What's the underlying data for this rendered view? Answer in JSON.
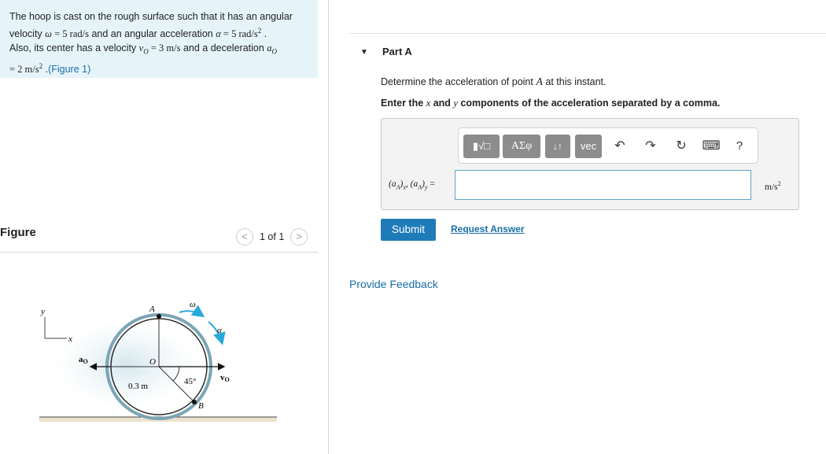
{
  "problem": {
    "line1": "The hoop is cast on the rough surface such that it has an angular",
    "line2_pre": "velocity ",
    "omega_sym": "ω",
    "line2_eq1": " = 5 rad/s",
    "line2_mid": " and an angular acceleration ",
    "alpha_sym": "α",
    "line2_eq2": " = 5 rad/s",
    "line2_exp": "2",
    "line2_end": " .",
    "line3_pre": "Also, its center has a velocity ",
    "vo_sym": "v",
    "vo_sub": "O",
    "line3_eq": " = 3 m/s",
    "line3_mid": " and a deceleration ",
    "ao_sym": "a",
    "ao_sub": "O",
    "line4_eq": "= 2 m/s",
    "line4_exp": "2",
    "line4_sep": " .",
    "figure_link": "(Figure 1)"
  },
  "figure_panel": {
    "title": "Figure",
    "prev": "<",
    "next": ">",
    "page_text": "1 of 1"
  },
  "figure": {
    "y_axis": "y",
    "x_axis": "x",
    "label_A": "A",
    "label_O": "O",
    "label_B": "B",
    "label_omega": "ω",
    "label_alpha": "α",
    "label_ao": "a",
    "label_ao_sub": "O",
    "label_vo": "v",
    "label_vo_sub": "O",
    "label_radius": "0.3 m",
    "label_angle": "45°"
  },
  "partA": {
    "title": "Part A",
    "prompt1_pre": "Determine the acceleration of point ",
    "prompt1_sym": "A",
    "prompt1_post": " at this instant.",
    "prompt2_a": "Enter the ",
    "prompt2_x": "x",
    "prompt2_b": " and ",
    "prompt2_y": "y",
    "prompt2_c": " components of the acceleration separated by a comma."
  },
  "toolbar": {
    "templates": "▮√□",
    "greek": "ΑΣφ",
    "arrows": "↓↑",
    "vec": "vec",
    "undo": "↶",
    "redo": "↷",
    "reset": "↻",
    "keyboard": "⌨",
    "help": "?"
  },
  "answer": {
    "label_a": "(a",
    "label_sub1": "A",
    "label_b": ")",
    "label_x": "x",
    "label_comma": ", (a",
    "label_sub2": "A",
    "label_c": ")",
    "label_y": "y",
    "label_eq": " =",
    "value": "",
    "unit": "m/s",
    "unit_exp": "2"
  },
  "actions": {
    "submit": "Submit",
    "request": "Request Answer",
    "feedback": "Provide Feedback"
  },
  "colors": {
    "accent": "#1f7bb8",
    "link": "#1a6ea8",
    "problem_bg": "#e6f4f9",
    "arrow_cyan": "#29a9d9",
    "hoop_outer": "#7aa5b4"
  }
}
